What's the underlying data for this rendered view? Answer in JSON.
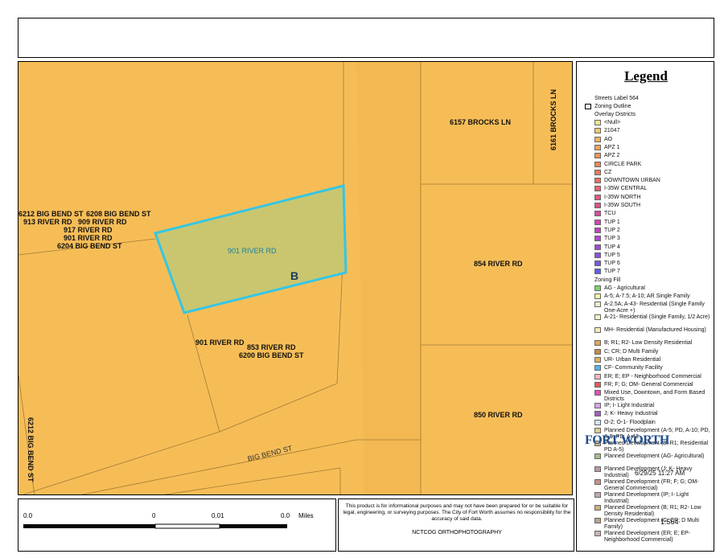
{
  "map": {
    "parcel_marker": "B",
    "labels": [
      {
        "id": "label-6157-brocks-ln",
        "text": "6157 BROCKS LN"
      },
      {
        "id": "label-6161-brocks-ln",
        "text": "6161 BROCKS LN"
      },
      {
        "id": "label-6212-big-bend-st-top",
        "text": "6212 BIG BEND ST"
      },
      {
        "id": "label-6208-big-bend-st",
        "text": "6208 BIG BEND ST"
      },
      {
        "id": "label-913-river-rd",
        "text": "913 RIVER RD"
      },
      {
        "id": "label-909-river-rd",
        "text": "909 RIVER RD"
      },
      {
        "id": "label-917-river-rd",
        "text": "917 RIVER RD"
      },
      {
        "id": "label-901-river-rd-west",
        "text": "901 RIVER RD"
      },
      {
        "id": "label-6204-big-bend-st",
        "text": "6204 BIG BEND ST"
      },
      {
        "id": "label-901-river-rd-parcel",
        "text": "901 RIVER RD"
      },
      {
        "id": "label-854-river-rd",
        "text": "854 RIVER RD"
      },
      {
        "id": "label-901-river-rd-south",
        "text": "901 RIVER RD"
      },
      {
        "id": "label-853-river-rd",
        "text": "853 RIVER RD"
      },
      {
        "id": "label-6200-big-bend-st",
        "text": "6200 BIG BEND ST"
      },
      {
        "id": "label-850-river-rd",
        "text": "850 RIVER RD"
      },
      {
        "id": "label-6212-big-bend-st-vertical",
        "text": "6212 BIG BEND ST"
      },
      {
        "id": "label-big-bend-st-road",
        "text": "BIG BEND ST"
      }
    ]
  },
  "legend": {
    "title": "Legend",
    "header_items": [
      "Streets Label 564",
      "Zoning Outline",
      "Overlay Districts"
    ],
    "overlay": [
      {
        "label": "<Null>",
        "color": "#f2e48f"
      },
      {
        "label": "21047",
        "color": "#f5c96b"
      },
      {
        "label": "AO",
        "color": "#f4b55e"
      },
      {
        "label": "APZ 1",
        "color": "#f2a45a"
      },
      {
        "label": "APZ 2",
        "color": "#f09358"
      },
      {
        "label": "CIRCLE PARK",
        "color": "#ee8758"
      },
      {
        "label": "CZ",
        "color": "#ec7a5c"
      },
      {
        "label": "DOWNTOWN URBAN",
        "color": "#ea6d62"
      },
      {
        "label": "I-35W CENTRAL",
        "color": "#e86270"
      },
      {
        "label": "I-35W NORTH",
        "color": "#e4587e"
      },
      {
        "label": "I-35W SOUTH",
        "color": "#e0508e"
      },
      {
        "label": "TCU",
        "color": "#da4aa0"
      },
      {
        "label": "TUP 1",
        "color": "#d046b4"
      },
      {
        "label": "TUP 2",
        "color": "#c444c4"
      },
      {
        "label": "TUP 3",
        "color": "#b446cf"
      },
      {
        "label": "TUP 4",
        "color": "#a04cd6"
      },
      {
        "label": "TUP 5",
        "color": "#8c52dc"
      },
      {
        "label": "TUP 6",
        "color": "#7458e0"
      },
      {
        "label": "TUP 7",
        "color": "#5c60e4"
      }
    ],
    "zoning_fill_label": "Zoning Fill",
    "zoning": [
      {
        "label": "AG - Agricultural",
        "color": "#7fd16a"
      },
      {
        "label": "A-5; A-7.5; A-10; AR Single Family",
        "color": "#f7f3a6"
      },
      {
        "label": "A-2.5A; A-43- Residential (Single Family One-Acre +)",
        "color": "#e6f2c8"
      },
      {
        "label": "A-21- Residential (Single Family, 1/2 Acre)",
        "color": "#fdf6c2"
      },
      {
        "label": "MH- Residential (Manufactured Housing)",
        "color": "#fbe9b8"
      },
      {
        "label": "B; R1; R2- Low Density Residential",
        "color": "#e4a65a"
      },
      {
        "label": "C; CR; D Multi Family",
        "color": "#c98a4c"
      },
      {
        "label": "UR- Urban Residential",
        "color": "#d9b25a"
      },
      {
        "label": "CF- Community Facility",
        "color": "#4fb8e4"
      },
      {
        "label": "ER; E; EP - Neighborhood Commercial",
        "color": "#f7b7c2"
      },
      {
        "label": "FR; F; G; OM- General Commercial",
        "color": "#e25a5a"
      },
      {
        "label": "Mixed Use, Downtown, and Form Based Districts",
        "color": "#e050b6"
      },
      {
        "label": "IP; I- Light Industrial",
        "color": "#d9a2e6"
      },
      {
        "label": "J; K- Heavy Industrial",
        "color": "#a060c0"
      },
      {
        "label": "O-2; O-1- Floodplain",
        "color": "#cfe7f4"
      },
      {
        "label": "Planned Development (A-5; PD, A-10; PD, A-5; PD, A-43",
        "color": "#d8cc96"
      },
      {
        "label": "Planned Development (B; R1; Residential PD A-5)",
        "color": "#c8b888"
      },
      {
        "label": "Planned Development (AG- Agricultural)",
        "color": "#9fbf86"
      },
      {
        "label": "Planned Development (J; K- Heavy Industrial)",
        "color": "#b79aa6"
      },
      {
        "label": "Planned Development (FR; F; G; OM- General Commercial)",
        "color": "#c9908a"
      },
      {
        "label": "Planned Development (IP; I- Light Industrial)",
        "color": "#c4a6b4"
      },
      {
        "label": "Planned Development (B; R1; R2- Low Density Residential)",
        "color": "#c9b07a"
      },
      {
        "label": "Planned Development (C; CR; D Multi Family)",
        "color": "#b8a48a"
      },
      {
        "label": "Planned Development (ER; E; EP- Neighborhood Commercial)",
        "color": "#cdb4b4"
      }
    ],
    "logo_text": "FORT WORTH",
    "timestamp": "6/29/25 11:27 AM",
    "scale_ratio": "1:564"
  },
  "scale": {
    "ticks": [
      "0.0",
      "0",
      "0.01",
      "0.0"
    ],
    "units": "Miles"
  },
  "footer": {
    "disclaimer": "This product is for informational purposes and may not have been prepared for or be suitable for legal, engineering, or surveying purposes. The City of Fort Worth assumes no responsibility for the accuracy of said data.",
    "credit": "NCTCOG ORTHOPHOTOGRAPHY"
  },
  "colors": {
    "parcel_fill": "#c9c66f",
    "parcel_outline": "#35c6e4",
    "zoning_fill": "#f6bd57",
    "property_lines": "#8a6a2a"
  }
}
